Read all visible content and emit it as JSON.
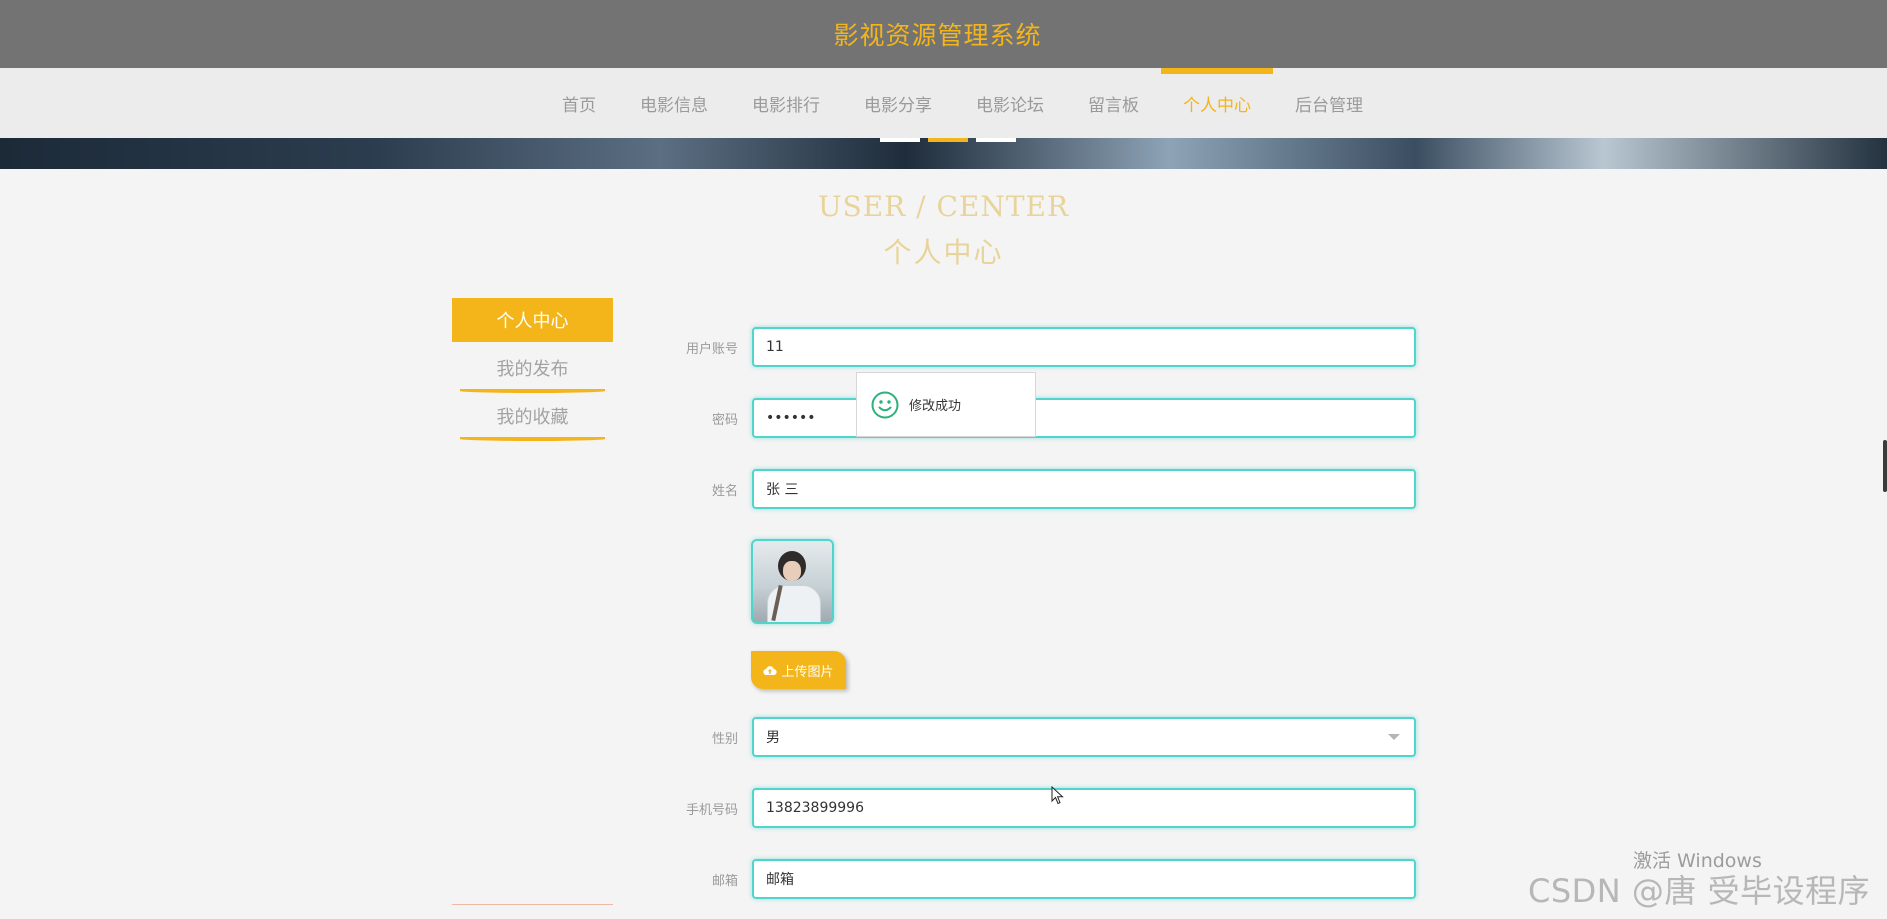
{
  "site": {
    "title": "影视资源管理系统"
  },
  "nav": {
    "items": [
      {
        "label": "首页",
        "active": false
      },
      {
        "label": "电影信息",
        "active": false
      },
      {
        "label": "电影排行",
        "active": false
      },
      {
        "label": "电影分享",
        "active": false
      },
      {
        "label": "电影论坛",
        "active": false
      },
      {
        "label": "留言板",
        "active": false
      },
      {
        "label": "个人中心",
        "active": true
      },
      {
        "label": "后台管理",
        "active": false
      }
    ]
  },
  "section": {
    "en": "USER / CENTER",
    "cn": "个人中心"
  },
  "sidebar": {
    "items": [
      {
        "label": "个人中心",
        "active": true
      },
      {
        "label": "我的发布",
        "active": false
      },
      {
        "label": "我的收藏",
        "active": false
      }
    ]
  },
  "form": {
    "account": {
      "label": "用户账号",
      "value": "11"
    },
    "password": {
      "label": "密码",
      "value": "••••••"
    },
    "name": {
      "label": "姓名",
      "value": "张 三"
    },
    "upload": {
      "label": "上传图片"
    },
    "gender": {
      "label": "性别",
      "value": "男"
    },
    "phone": {
      "label": "手机号码",
      "value": "13823899996"
    },
    "email": {
      "label": "邮箱",
      "value": "邮箱"
    }
  },
  "toast": {
    "message": "修改成功"
  },
  "watermarks": {
    "windows": "激活 Windows",
    "csdn": "CSDN @唐 受毕设程序"
  },
  "colors": {
    "accent": "#f3b51a",
    "input_border": "#50d4cc",
    "header_bg": "#737373",
    "success": "#2bb27a"
  }
}
